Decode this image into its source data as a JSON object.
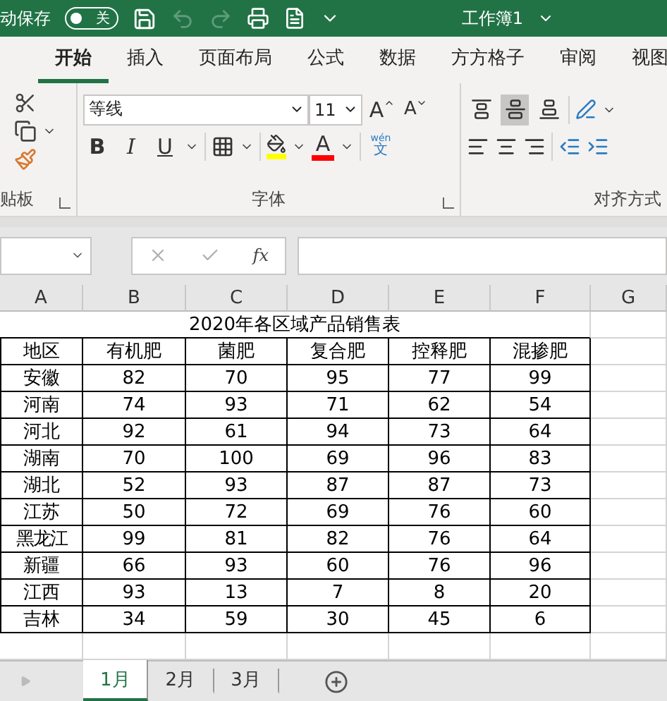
{
  "title_bar": {
    "autosave_label": "动保存",
    "autosave_toggle": {
      "label": "关",
      "on": false
    },
    "title": "工作簿1"
  },
  "ribbon_tabs": [
    {
      "label": "开始",
      "selected": true
    },
    {
      "label": "插入",
      "selected": false
    },
    {
      "label": "页面布局",
      "selected": false
    },
    {
      "label": "公式",
      "selected": false
    },
    {
      "label": "数据",
      "selected": false
    },
    {
      "label": "方方格子",
      "selected": false
    },
    {
      "label": "审阅",
      "selected": false
    },
    {
      "label": "视图",
      "selected": false
    }
  ],
  "ribbon": {
    "font_name": "等线",
    "font_size": "11",
    "grow_label": "A",
    "shrink_label": "A",
    "bold": "B",
    "italic": "I",
    "underline": "U",
    "font_color_label": "A",
    "phonetic_top": "wén",
    "phonetic_bottom": "文",
    "vertical_align": [
      {
        "selected": false
      },
      {
        "selected": true
      },
      {
        "selected": false
      }
    ],
    "groups": [
      "贴板",
      "字体",
      "对齐方式"
    ]
  },
  "formula_bar": {
    "fx": "fx"
  },
  "columns": [
    "A",
    "B",
    "C",
    "D",
    "E",
    "F",
    "G"
  ],
  "sheet": {
    "title": "2020年各区域产品销售表",
    "header": [
      "地区",
      "有机肥",
      "菌肥",
      "复合肥",
      "控释肥",
      "混掺肥"
    ],
    "rows": [
      [
        "安徽",
        "82",
        "70",
        "95",
        "77",
        "99"
      ],
      [
        "河南",
        "74",
        "93",
        "71",
        "62",
        "54"
      ],
      [
        "河北",
        "92",
        "61",
        "94",
        "73",
        "64"
      ],
      [
        "湖南",
        "70",
        "100",
        "69",
        "96",
        "83"
      ],
      [
        "湖北",
        "52",
        "93",
        "87",
        "87",
        "73"
      ],
      [
        "江苏",
        "50",
        "72",
        "69",
        "76",
        "60"
      ],
      [
        "黑龙江",
        "99",
        "81",
        "82",
        "76",
        "64"
      ],
      [
        "新疆",
        "66",
        "93",
        "60",
        "76",
        "96"
      ],
      [
        "江西",
        "93",
        "13",
        "7",
        "8",
        "20"
      ],
      [
        "吉林",
        "34",
        "59",
        "30",
        "45",
        "6"
      ]
    ]
  },
  "sheet_tabs": [
    {
      "label": "1月",
      "selected": true
    },
    {
      "label": "2月",
      "selected": false
    },
    {
      "label": "3月",
      "selected": false
    }
  ]
}
